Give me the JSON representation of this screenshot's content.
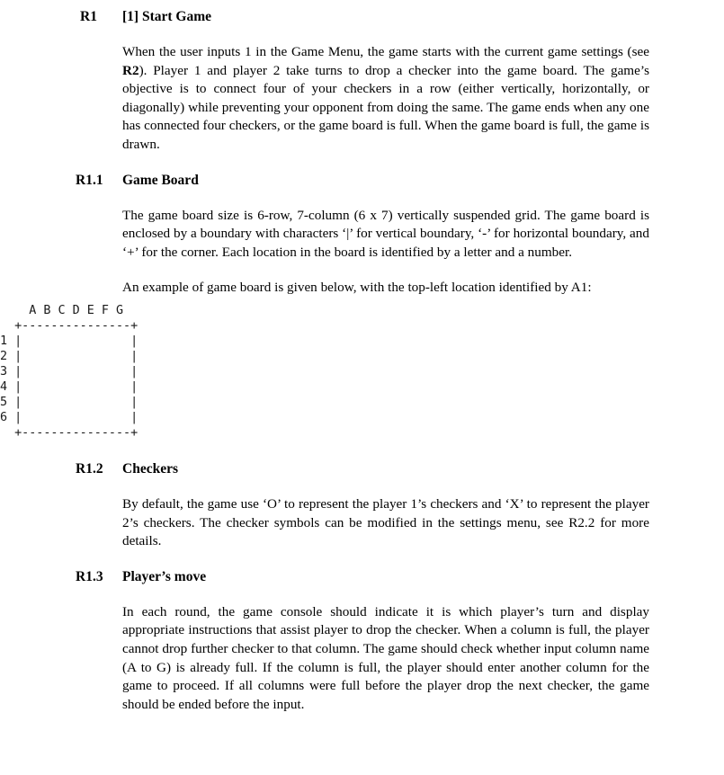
{
  "document": {
    "sections": [
      {
        "id": "R1",
        "label": "R1",
        "title": "[1] Start Game",
        "level": 1,
        "paragraphs": [
          {
            "parts": [
              {
                "text": "When the user inputs 1 in the Game Menu, the game starts with the current game settings (see ",
                "bold": false
              },
              {
                "text": "R2",
                "bold": true
              },
              {
                "text": "). Player 1 and player 2 take turns to drop a checker into the game board. The game’s objective is to connect four of your checkers in a row (either vertically, horizontally, or diagonally) while preventing your opponent from doing the same. The game ends when any one has connected four checkers, or the game board is full. When the game board is full, the game is drawn.",
                "bold": false
              }
            ]
          }
        ]
      },
      {
        "id": "R1.1",
        "label": "R1.1",
        "title": "Game Board",
        "level": 2,
        "paragraphs": [
          {
            "parts": [
              {
                "text": "The game board size is 6-row, 7-column (6 x 7) vertically suspended grid. The game board is enclosed by a boundary with characters ‘|’ for vertical boundary, ‘-’ for horizontal boundary, and ‘+’ for the corner. Each location in the board is identified by a letter and a number.",
                "bold": false
              }
            ]
          },
          {
            "parts": [
              {
                "text": "An example of game board is given below, with the top-left location identified by A1:",
                "bold": false
              }
            ]
          }
        ]
      },
      {
        "id": "R1.2",
        "label": "R1.2",
        "title": "Checkers",
        "level": 2,
        "paragraphs": [
          {
            "parts": [
              {
                "text": "By default, the game use ‘O’ to represent the player 1’s checkers and ‘X’ to represent the player 2’s checkers. The checker symbols can be modified in the settings menu, see R2.2 for more details.",
                "bold": false
              }
            ]
          }
        ]
      },
      {
        "id": "R1.3",
        "label": "R1.3",
        "title": "Player’s move",
        "level": 2,
        "paragraphs": [
          {
            "parts": [
              {
                "text": "In each round, the game console should indicate it is which player’s turn and display appropriate instructions that assist player to drop the checker. When a column is full, the player cannot drop further checker to that column. The game should check whether input column name (A to G) is already full. If the column is full, the player should enter another column for the game to proceed. If all columns were full before the player drop the next checker, the game should be ended before the input.",
                "bold": false
              }
            ]
          }
        ]
      }
    ]
  },
  "game_board_figure": {
    "caption": "An example of game board is given below, with the top-left location identified by A1:",
    "column_headers": [
      "A",
      "B",
      "C",
      "D",
      "E",
      "F",
      "G"
    ],
    "row_labels": [
      "1",
      "2",
      "3",
      "4",
      "5",
      "6"
    ],
    "rows": 6,
    "columns": 7,
    "vertical_boundary_char": "|",
    "horizontal_boundary_char": "-",
    "corner_char": "+",
    "ascii": "    A B C D E F G\n  +---------------+\n1 |               |\n2 |               |\n3 |               |\n4 |               |\n5 |               |\n6 |               |\n  +---------------+"
  },
  "headings": {
    "r1_label": "R1",
    "r1_title": "[1] Start Game",
    "r11_label": "R1.1",
    "r11_title": "Game Board",
    "r12_label": "R1.2",
    "r12_title": "Checkers",
    "r13_label": "R1.3",
    "r13_title": "Player’s move"
  },
  "paragraphs": {
    "r1_body_pre": "When the user inputs 1 in the Game Menu, the game starts with the current game settings (see ",
    "r1_body_bold": "R2",
    "r1_body_post": "). Player 1 and player 2 take turns to drop a checker into the game board. The game’s objective is to connect four of your checkers in a row (either vertically, horizontally, or diagonally) while preventing your opponent from doing the same. The game ends when any one has connected four checkers, or the game board is full. When the game board is full, the game is drawn.",
    "r11_body": "The game board size is 6-row, 7-column (6 x 7) vertically suspended grid. The game board is enclosed by a boundary with characters ‘|’ for vertical boundary, ‘-’ for horizontal boundary, and ‘+’ for the corner. Each location in the board is identified by a letter and a number.",
    "r11_figure_intro": "An example of game board is given below, with the top-left location identified by A1:",
    "r12_body": "By default, the game use ‘O’ to represent the player 1’s checkers and ‘X’ to represent the player 2’s checkers. The checker symbols can be modified in the settings menu, see R2.2 for more details.",
    "r13_body": "In each round, the game console should indicate it is which player’s turn and display appropriate instructions that assist player to drop the checker. When a column is full, the player cannot drop further checker to that column. The game should check whether input column name (A to G) is already full. If the column is full, the player should enter another column for the game to proceed. If all columns were full before the player drop the next checker, the game should be ended before the input."
  },
  "colors": {
    "background": "#ffffff",
    "text": "#000000",
    "ascii_text": "#1a1a1a"
  }
}
